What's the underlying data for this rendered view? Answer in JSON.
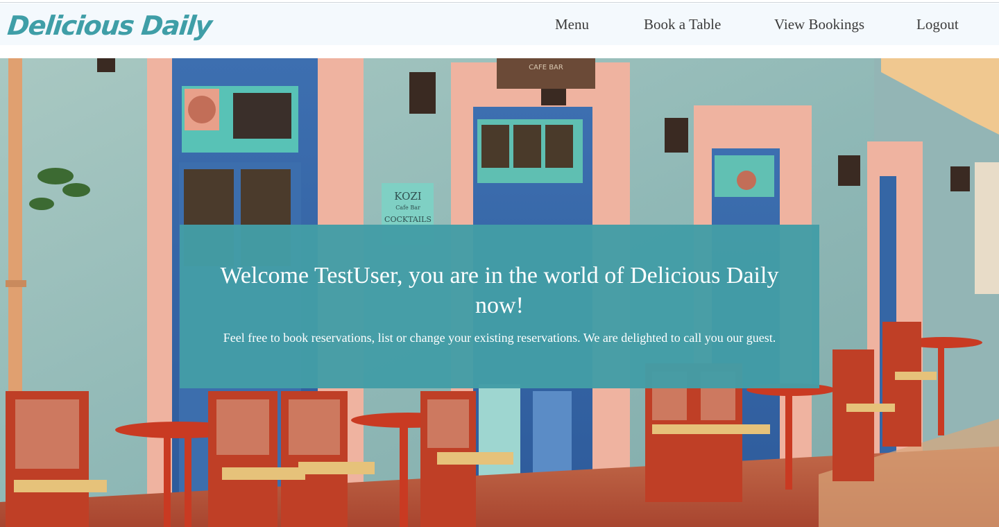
{
  "brand": {
    "name": "Delicious Daily"
  },
  "nav": {
    "items": [
      {
        "label": "Menu"
      },
      {
        "label": "Book a Table"
      },
      {
        "label": "View Bookings"
      },
      {
        "label": "Logout"
      }
    ]
  },
  "hero": {
    "title": "Welcome TestUser, you are in the world of Delicious Daily now!",
    "subtitle": "Feel free to book reservations, list or change your existing reservations. We are delighted to call you our guest.",
    "sign_top": "CAFE BAR",
    "sign_bottom": "KOZI",
    "sign_bottom_sub": "Cafe Bar",
    "sign_bottom_2": "COCKTAILS"
  },
  "colors": {
    "brand": "#3f9ea7",
    "welcome_box": "#439da6",
    "nav_bg": "#f4f9fd"
  }
}
